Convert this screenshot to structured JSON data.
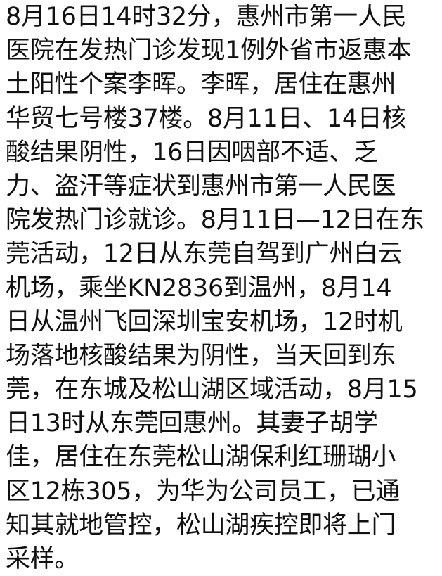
{
  "post": {
    "lines": [
      "8月16日14时32分，惠州市第一人民",
      "医院在发热门诊发现1例外省市返惠本",
      "土阳性个案李晖。李晖，居住在惠州",
      "华贸七号楼37楼。8月11日、14日核",
      "酸结果阴性，16日因咽部不适、乏",
      "力、盗汗等症状到惠州市第一人民医",
      "院发热门诊就诊。8月11日—12日在东",
      "莞活动，12日从东莞自驾到广州白云",
      "机场，乘坐KN2836到温州，8月14",
      "日从温州飞回深圳宝安机场，12时机",
      "场落地核酸结果为阴性，当天回到东",
      "莞，在东城及松山湖区域活动，8月15",
      "日13时从东莞回惠州。其妻子胡学",
      "佳，居住在东莞松山湖保利红珊瑚小",
      "区12栋305，为华为公司员工，已通",
      "知其就地管控，松山湖疾控即将上门",
      "采样。"
    ]
  }
}
